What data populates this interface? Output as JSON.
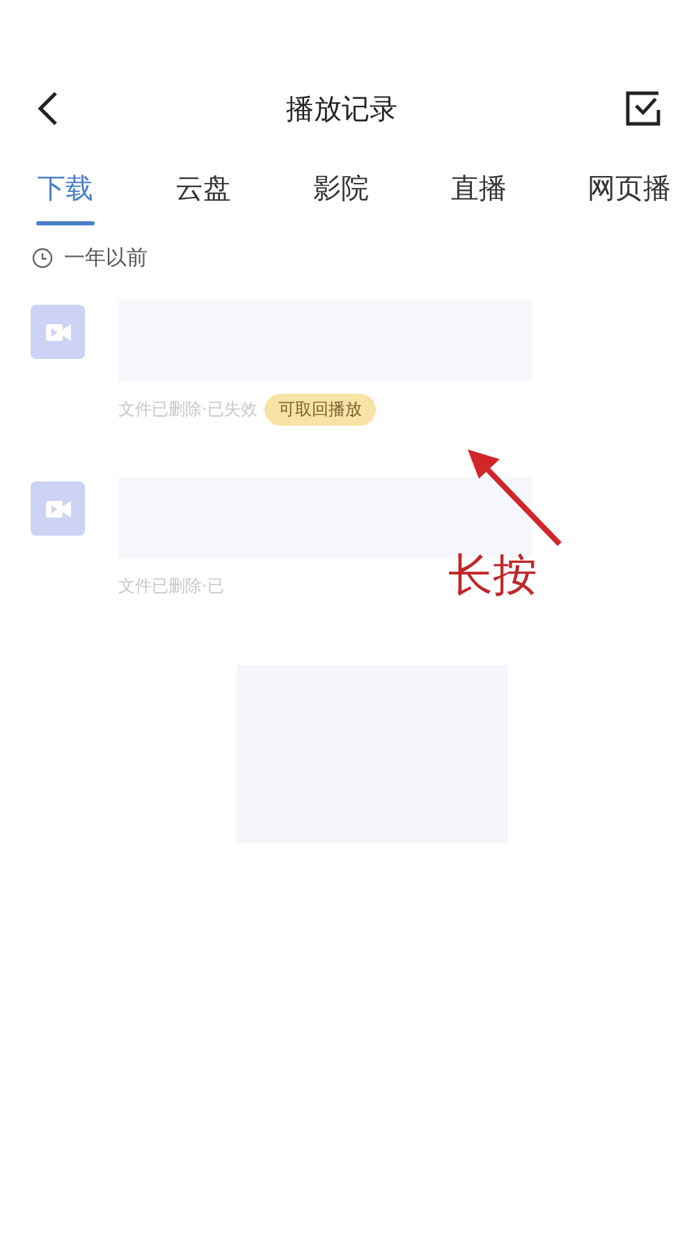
{
  "header": {
    "title": "播放记录"
  },
  "tabs": [
    {
      "label": "下载",
      "selected": true
    },
    {
      "label": "云盘",
      "selected": false
    },
    {
      "label": "影院",
      "selected": false
    },
    {
      "label": "直播",
      "selected": false
    },
    {
      "label": "网页播",
      "selected": false
    }
  ],
  "section": {
    "label": "一年以前"
  },
  "items": [
    {
      "status": "文件已删除·已失效",
      "badge": "可取回播放"
    },
    {
      "status": "文件已删除·已"
    }
  ],
  "annotation": {
    "text": "长按"
  }
}
